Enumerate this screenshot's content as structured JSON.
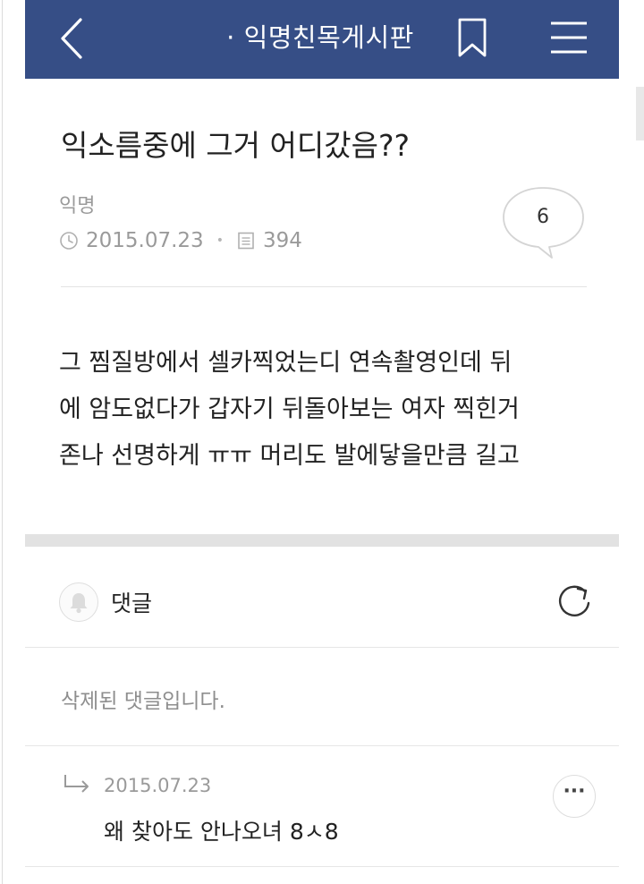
{
  "header": {
    "board_name": "· 익명친목게시판",
    "back_icon": "chevron-left-icon",
    "bookmark_icon": "bookmark-icon",
    "menu_icon": "hamburger-menu-icon",
    "bar_color": "#364e86"
  },
  "post": {
    "title": "익소름중에 그거 어디갔음??",
    "author": "익명",
    "date": "2015.07.23",
    "views": "394",
    "comment_count": "6",
    "body_lines": [
      "그 찜질방에서 셀카찍었는디 연속촬영인데 뒤",
      "에 암도없다가 갑자기 뒤돌아보는 여자 찍힌거",
      "존나 선명하게 ㅠㅠ 머리도 발에닿을만큼 길고"
    ]
  },
  "comments": {
    "header_label": "댓글",
    "deleted_text": "삭제된 댓글입니다.",
    "reply": {
      "date": "2015.07.23",
      "text": "왜 찾아도 안나오녀 8ㅅ8",
      "more_label": "···"
    }
  }
}
